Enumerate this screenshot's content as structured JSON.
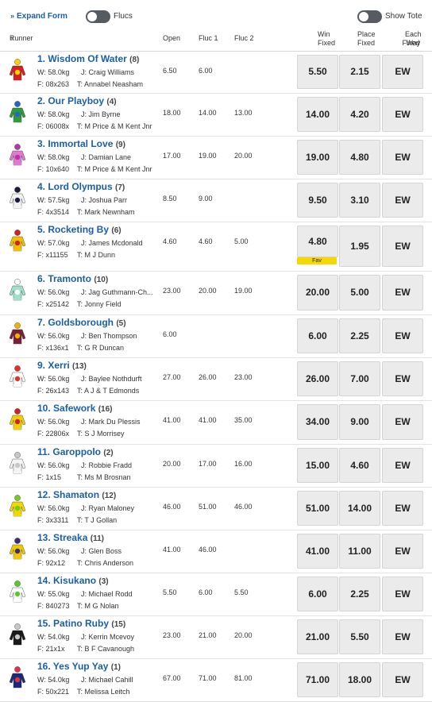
{
  "toolbar": {
    "expand_form_label": "Expand Form",
    "flucs_label": "Flucs",
    "show_tote_label": "Show Tote"
  },
  "columns": {
    "runner": "Runner",
    "open": "Open",
    "fluc1": "Fluc 1",
    "fluc2": "Fluc 2",
    "win_fixed_1": "Win",
    "win_fixed_2": "Fixed",
    "place_fixed_1": "Place",
    "place_fixed_2": "Fixed",
    "each_way_1": "Each Way",
    "each_way_2": "Fixed"
  },
  "runners": [
    {
      "name": "1. Wisdom Of Water",
      "barrier": "(8)",
      "weight": "W: 58.0kg",
      "jockey": "J: Craig Williams",
      "form": "F: 08x263",
      "trainer": "T: Annabel Neasham",
      "open": "6.50",
      "fluc1": "6.00",
      "fluc2": "",
      "win": "5.50",
      "place": "2.15",
      "ew": "EW",
      "fav": "",
      "silk": [
        "#d32020",
        "#f7d200",
        "#d32020"
      ]
    },
    {
      "name": "2. Our Playboy",
      "barrier": "(4)",
      "weight": "W: 58.0kg",
      "jockey": "J: Jim Byrne",
      "form": "F: 06008x",
      "trainer": "T: M Price & M Kent Jnr",
      "open": "18.00",
      "fluc1": "14.00",
      "fluc2": "13.00",
      "win": "14.00",
      "place": "4.20",
      "ew": "EW",
      "fav": "",
      "silk": [
        "#2e9a3a",
        "#2366c6",
        "#2e9a3a"
      ]
    },
    {
      "name": "3. Immortal Love",
      "barrier": "(9)",
      "weight": "W: 58.0kg",
      "jockey": "J: Damian Lane",
      "form": "F: 10x640",
      "trainer": "T: M Price & M Kent Jnr",
      "open": "17.00",
      "fluc1": "19.00",
      "fluc2": "20.00",
      "win": "19.00",
      "place": "4.80",
      "ew": "EW",
      "fav": "",
      "silk": [
        "#e07ad0",
        "#b03aa8",
        "#e07ad0"
      ]
    },
    {
      "name": "4. Lord Olympus",
      "barrier": "(7)",
      "weight": "W: 57.5kg",
      "jockey": "J: Joshua Parr",
      "form": "F: 4x3514",
      "trainer": "T: Mark Newnham",
      "open": "8.50",
      "fluc1": "9.00",
      "fluc2": "",
      "win": "9.50",
      "place": "3.10",
      "ew": "EW",
      "fav": "",
      "silk": [
        "#f2f2f2",
        "#1b1b3a",
        "#f2f2f2"
      ]
    },
    {
      "name": "5. Rocketing By",
      "barrier": "(6)",
      "weight": "W: 57.0kg",
      "jockey": "J: James Mcdonald",
      "form": "F: x11155",
      "trainer": "T: M J Dunn",
      "open": "4.60",
      "fluc1": "4.60",
      "fluc2": "5.00",
      "win": "4.80",
      "place": "1.95",
      "ew": "EW",
      "fav": "Fav",
      "silk": [
        "#f0c000",
        "#d32020",
        "#f0c000"
      ]
    },
    {
      "name": "6. Tramonto",
      "barrier": "(10)",
      "weight": "W: 56.0kg",
      "jockey": "J: Jag Guthmann-Ch...",
      "form": "F: x25142",
      "trainer": "T: Jonny Field",
      "open": "23.00",
      "fluc1": "20.00",
      "fluc2": "19.00",
      "win": "20.00",
      "place": "5.00",
      "ew": "EW",
      "fav": "",
      "silk": [
        "#9fe0c8",
        "#ffffff",
        "#9fe0c8"
      ]
    },
    {
      "name": "7. Goldsborough",
      "barrier": "(5)",
      "weight": "W: 56.0kg",
      "jockey": "J: Ben Thompson",
      "form": "F: x136x1",
      "trainer": "T: G R Duncan",
      "open": "6.00",
      "fluc1": "",
      "fluc2": "",
      "win": "6.00",
      "place": "2.25",
      "ew": "EW",
      "fav": "",
      "silk": [
        "#7a1f3a",
        "#f0b400",
        "#7a1f3a"
      ]
    },
    {
      "name": "9. Xerri",
      "barrier": "(13)",
      "weight": "W: 56.0kg",
      "jockey": "J: Baylee Nothdurft",
      "form": "F: 26x143",
      "trainer": "T: A J & T Edmonds",
      "open": "27.00",
      "fluc1": "26.00",
      "fluc2": "23.00",
      "win": "26.00",
      "place": "7.00",
      "ew": "EW",
      "fav": "",
      "silk": [
        "#ffffff",
        "#e03030",
        "#ffffff"
      ]
    },
    {
      "name": "10. Safework",
      "barrier": "(16)",
      "weight": "W: 56.0kg",
      "jockey": "J: Mark Du Plessis",
      "form": "F: 22806x",
      "trainer": "T: S J Morrisey",
      "open": "41.00",
      "fluc1": "41.00",
      "fluc2": "35.00",
      "win": "34.00",
      "place": "9.00",
      "ew": "EW",
      "fav": "",
      "silk": [
        "#f0d000",
        "#d32020",
        "#f0d000"
      ]
    },
    {
      "name": "11. Garoppolo",
      "barrier": "(2)",
      "weight": "W: 56.0kg",
      "jockey": "J: Robbie Fradd",
      "form": "F: 1x15",
      "trainer": "T: Ms M Brosnan",
      "open": "20.00",
      "fluc1": "17.00",
      "fluc2": "16.00",
      "win": "15.00",
      "place": "4.60",
      "ew": "EW",
      "fav": "",
      "silk": [
        "#f4f4f4",
        "#c8c8c8",
        "#f4f4f4"
      ]
    },
    {
      "name": "12. Shamaton",
      "barrier": "(12)",
      "weight": "W: 56.0kg",
      "jockey": "J: Ryan Maloney",
      "form": "F: 3x3311",
      "trainer": "T: T J Gollan",
      "open": "46.00",
      "fluc1": "51.00",
      "fluc2": "46.00",
      "win": "51.00",
      "place": "14.00",
      "ew": "EW",
      "fav": "",
      "silk": [
        "#f0d800",
        "#7ac820",
        "#f0d800"
      ]
    },
    {
      "name": "13. Streaka",
      "barrier": "(11)",
      "weight": "W: 56.0kg",
      "jockey": "J: Glen Boss",
      "form": "F: 92x12",
      "trainer": "T: Chris Anderson",
      "open": "41.00",
      "fluc1": "46.00",
      "fluc2": "",
      "win": "41.00",
      "place": "11.00",
      "ew": "EW",
      "fav": "",
      "silk": [
        "#f0c800",
        "#3a2a80",
        "#f0c800"
      ]
    },
    {
      "name": "14. Kisukano",
      "barrier": "(3)",
      "weight": "W: 55.0kg",
      "jockey": "J: Michael Rodd",
      "form": "F: 840273",
      "trainer": "T: M G Nolan",
      "open": "5.50",
      "fluc1": "6.00",
      "fluc2": "5.50",
      "win": "6.00",
      "place": "2.25",
      "ew": "EW",
      "fav": "",
      "silk": [
        "#ffffff",
        "#5ac82a",
        "#ffffff"
      ]
    },
    {
      "name": "15. Patino Ruby",
      "barrier": "(15)",
      "weight": "W: 54.0kg",
      "jockey": "J: Kerrin Mcevoy",
      "form": "F: 21x1x",
      "trainer": "T: B F Cavanough",
      "open": "23.00",
      "fluc1": "21.00",
      "fluc2": "20.00",
      "win": "21.00",
      "place": "5.50",
      "ew": "EW",
      "fav": "",
      "silk": [
        "#1a1a1a",
        "#c8c8c8",
        "#1a1a1a"
      ]
    },
    {
      "name": "16. Yes Yup Yay",
      "barrier": "(1)",
      "weight": "W: 54.0kg",
      "jockey": "J: Michael Cahill",
      "form": "F: 50x221",
      "trainer": "T: Melissa Leitch",
      "open": "67.00",
      "fluc1": "71.00",
      "fluc2": "81.00",
      "win": "71.00",
      "place": "18.00",
      "ew": "EW",
      "fav": "",
      "silk": [
        "#1a2a7a",
        "#e0304a",
        "#1a2a7a"
      ]
    }
  ]
}
